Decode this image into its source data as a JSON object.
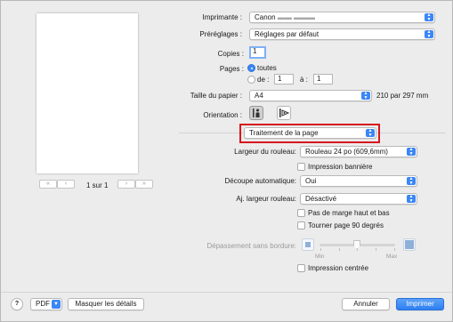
{
  "printer": {
    "label": "Imprimante :",
    "value": "Canon"
  },
  "presets": {
    "label": "Préréglages :",
    "value": "Réglages par défaut"
  },
  "copies": {
    "label": "Copies :",
    "value": "1"
  },
  "pages": {
    "label": "Pages :",
    "all_label": "toutes",
    "from_label": "de :",
    "from_value": "1",
    "to_label": "à :",
    "to_value": "1"
  },
  "paper": {
    "label": "Taille du papier :",
    "value": "A4",
    "dims": "210 par 297 mm"
  },
  "orientation": {
    "label": "Orientation :"
  },
  "section": {
    "value": "Traitement de la page"
  },
  "roll_width": {
    "label": "Largeur du rouleau:",
    "value": "Rouleau 24 po (609,6mm)"
  },
  "banner": {
    "label": "Impression bannière"
  },
  "auto_cut": {
    "label": "Découpe automatique:",
    "value": "Oui"
  },
  "fit_roll": {
    "label": "Aj. largeur rouleau:",
    "value": "Désactivé"
  },
  "no_margin": {
    "label": "Pas de marge haut et bas"
  },
  "rotate": {
    "label": "Tourner page 90 degrés"
  },
  "borderless": {
    "label": "Dépassement sans bordure:",
    "min": "Min",
    "max": "Max"
  },
  "center": {
    "label": "Impression centrée"
  },
  "preview": {
    "page_label": "1 sur 1"
  },
  "footer": {
    "help": "?",
    "pdf": "PDF",
    "hide_details": "Masquer les détails",
    "cancel": "Annuler",
    "print": "Imprimer"
  }
}
